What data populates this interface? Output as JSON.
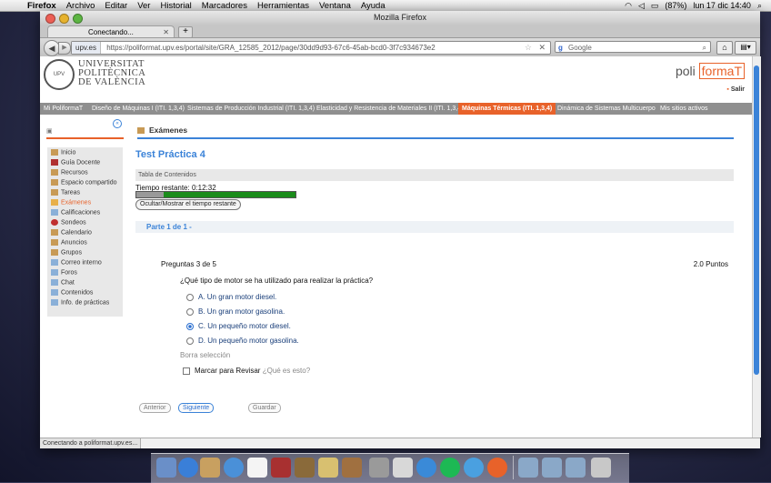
{
  "menubar": {
    "items": [
      "Firefox",
      "Archivo",
      "Editar",
      "Ver",
      "Historial",
      "Marcadores",
      "Herramientas",
      "Ventana",
      "Ayuda"
    ],
    "battery": "(87%)",
    "clock": "lun 17 dic  14:40"
  },
  "window": {
    "title": "Mozilla Firefox",
    "tab_title": "Conectando...",
    "url_site": "upv.es",
    "url": "https://poliformat.upv.es/portal/site/GRA_12585_2012/page/30dd9d93-67c6-45ab-bcd0-3f7c934673e2",
    "search_engine": "Google",
    "status": "Conectando a poliformat.upv.es..."
  },
  "header": {
    "univ_line1": "UNIVERSITAT",
    "univ_line2": "POLITÈCNICA",
    "univ_line3": "DE VALÈNCIA",
    "logo_poli": "poli",
    "logo_format": "formaT",
    "salir": "Salir"
  },
  "sites_nav": [
    "Mi PoliformaT",
    "Diseño de Máquinas I (ITI. 1,3,4)",
    "Sistemas de Producción Industrial (ITI. 1,3,4)",
    "Elasticidad y Resistencia de Materiales II (ITI. 1,3,4)",
    "Máquinas Térmicas (ITI. 1,3,4)",
    "Dinámica de Sistemas Multicuerpo",
    "Mis sitios activos"
  ],
  "tool_menu": [
    "Inicio",
    "Guía Docente",
    "Recursos",
    "Espacio compartido",
    "Tareas",
    "Exámenes",
    "Calificaciones",
    "Sondeos",
    "Calendario",
    "Anuncios",
    "Grupos",
    "Correo interno",
    "Foros",
    "Chat",
    "Contenidos",
    "Info. de prácticas"
  ],
  "tool_header": "Exámenes",
  "test": {
    "title": "Test Práctica 4",
    "toc": "Tabla de Contenidos",
    "timer_label": "Tiempo restante: 0:12:32",
    "elapsed_fraction": 0.17,
    "toggle_label": "Ocultar/Mostrar el tiempo restante",
    "part": "Parte 1 de 1 -",
    "question_count": "Preguntas 3 de 5",
    "points": "2.0 Puntos",
    "question": "¿Qué tipo de motor se ha utilizado para realizar la práctica?",
    "options": [
      {
        "label": "A. Un gran motor diesel.",
        "selected": false
      },
      {
        "label": "B. Un gran motor gasolina.",
        "selected": false
      },
      {
        "label": "C. Un pequeño motor diesel.",
        "selected": true
      },
      {
        "label": "D. Un pequeño motor gasolina.",
        "selected": false
      }
    ],
    "clear": "Borra selección",
    "review_label": "Marcar para Revisar",
    "review_help": "¿Qué es esto?",
    "buttons": {
      "prev": "Anterior",
      "next": "Siguiente",
      "save": "Guardar"
    }
  },
  "colors": {
    "accent": "#3b83d8",
    "brand": "#e8622a",
    "timer_bar": "#1b8c1b"
  }
}
